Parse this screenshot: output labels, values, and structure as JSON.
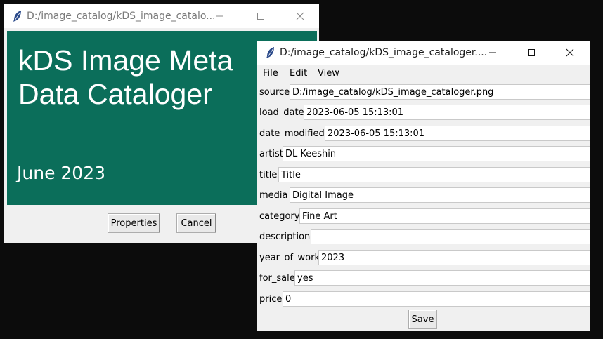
{
  "window1": {
    "title": "D:/image_catalog/kDS_image_catalo...",
    "banner": {
      "title": "kDS Image Meta\nData Cataloger",
      "date": "June 2023",
      "color": "#0b6e5a"
    },
    "buttons": {
      "properties": "Properties",
      "cancel": "Cancel"
    }
  },
  "window2": {
    "title": "D:/image_catalog/kDS_image_cataloger....",
    "menu": [
      "File",
      "Edit",
      "View"
    ],
    "fields": [
      {
        "label": "source",
        "value": "D:/image_catalog/kDS_image_cataloger.png"
      },
      {
        "label": "load_date",
        "value": "2023-06-05 15:13:01"
      },
      {
        "label": "date_modified",
        "value": "2023-06-05 15:13:01"
      },
      {
        "label": "artist",
        "value": "DL Keeshin"
      },
      {
        "label": "title",
        "value": "Title"
      },
      {
        "label": "media",
        "value": "Digital Image"
      },
      {
        "label": "category",
        "value": "Fine Art"
      },
      {
        "label": "description",
        "value": ""
      },
      {
        "label": "year_of_work",
        "value": "2023"
      },
      {
        "label": "for_sale",
        "value": "yes"
      },
      {
        "label": "price",
        "value": "0"
      }
    ],
    "save_label": "Save"
  },
  "icons": {
    "app": "feather-icon",
    "minimize": "minimize-icon",
    "maximize": "maximize-icon",
    "close": "close-icon"
  }
}
